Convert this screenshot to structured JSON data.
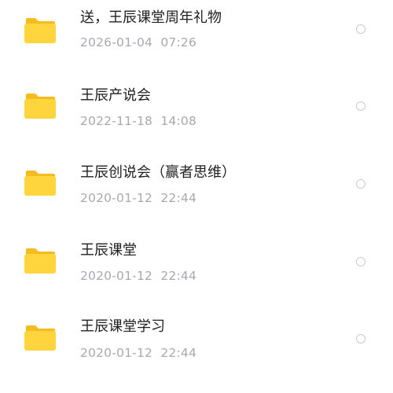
{
  "files": [
    {
      "name": "送，王辰课堂周年礼物",
      "date": "2026-01-04  07:26",
      "icon": "folder-icon"
    },
    {
      "name": "王辰产说会",
      "date": "2022-11-18  14:08",
      "icon": "folder-icon"
    },
    {
      "name": "王辰创说会（赢者思维）",
      "date": "2020-01-12  22:44",
      "icon": "folder-icon"
    },
    {
      "name": "王辰课堂",
      "date": "2020-01-12  22:44",
      "icon": "folder-icon"
    },
    {
      "name": "王辰课堂学习",
      "date": "2020-01-12  22:44",
      "icon": "folder-icon"
    }
  ],
  "colors": {
    "folder_body": "#FFD53E",
    "folder_tab": "#F5BC1F",
    "text_primary": "#1F1F1F",
    "text_secondary": "#A7A9AE",
    "radio_border": "#C8C9CC"
  }
}
